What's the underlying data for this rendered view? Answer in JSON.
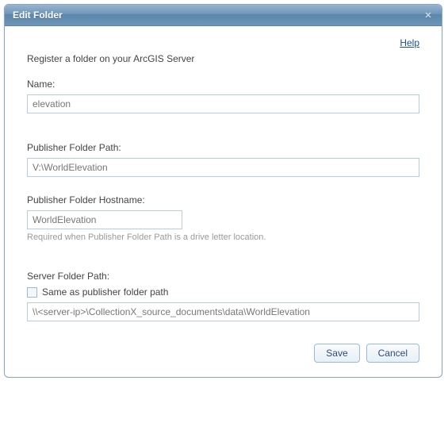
{
  "title": "Edit Folder",
  "help_label": "Help",
  "lead": "Register a folder on your ArcGIS Server",
  "name": {
    "label": "Name:",
    "value": "elevation"
  },
  "publisher_path": {
    "label": "Publisher Folder Path:",
    "value": "V:\\WorldElevation"
  },
  "publisher_host": {
    "label": "Publisher Folder Hostname:",
    "value": "WorldElevation",
    "hint": "Required when Publisher Folder Path is a drive letter location."
  },
  "server_path": {
    "label": "Server Folder Path:",
    "same_label": "Same as publisher folder path",
    "value": "\\\\<server-ip>\\CollectionX_source_documents\\data\\WorldElevation"
  },
  "buttons": {
    "save": "Save",
    "cancel": "Cancel"
  }
}
